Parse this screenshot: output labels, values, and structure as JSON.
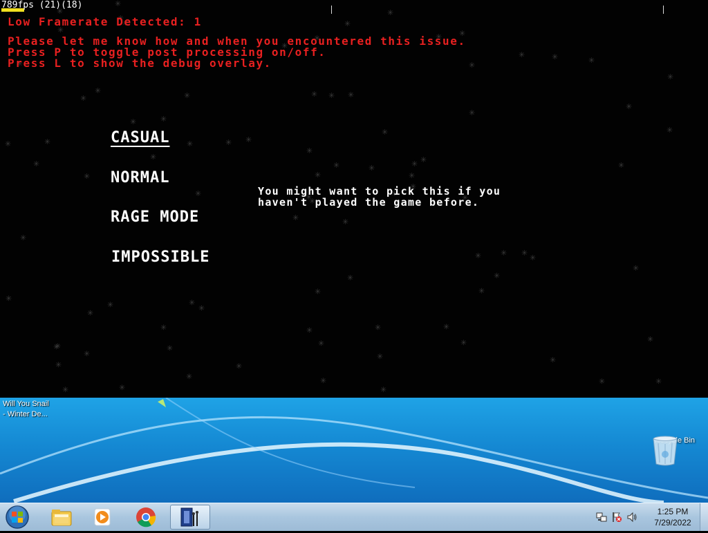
{
  "game": {
    "fps_text": "789fps (21)(18)",
    "debug_lines": [
      "Low Framerate Detected: 1",
      "Please let me know how and when you encountered this issue.",
      "Press P to toggle post processing on/off.",
      "Press L to show the debug overlay."
    ],
    "difficulty_menu": [
      {
        "label": "CASUAL",
        "selected": true
      },
      {
        "label": "NORMAL",
        "selected": false
      },
      {
        "label": "RAGE MODE",
        "selected": false
      },
      {
        "label": "IMPOSSIBLE",
        "selected": false
      }
    ],
    "description": "You might want to pick this if you\nhaven't played the game before."
  },
  "desktop": {
    "window_label_line1": "Will You Snail",
    "window_label_line2": "- Winter De...",
    "recycle_bin_label": "Recycle Bin"
  },
  "taskbar": {
    "buttons": [
      {
        "name": "start-orb-icon"
      },
      {
        "name": "windows-explorer-icon"
      },
      {
        "name": "media-player-icon"
      },
      {
        "name": "chrome-icon"
      },
      {
        "name": "game-app-icon",
        "active": true
      }
    ],
    "tray_icons": [
      "network-icon",
      "action-center-flag-icon",
      "volume-icon"
    ],
    "clock_time": "1:25 PM",
    "clock_date": "7/29/2022"
  },
  "colors": {
    "debug_text": "#e82020",
    "fps_bar": "#f2e020",
    "taskbar": "#a9c6df",
    "desktop_blue": "#1589d3"
  }
}
